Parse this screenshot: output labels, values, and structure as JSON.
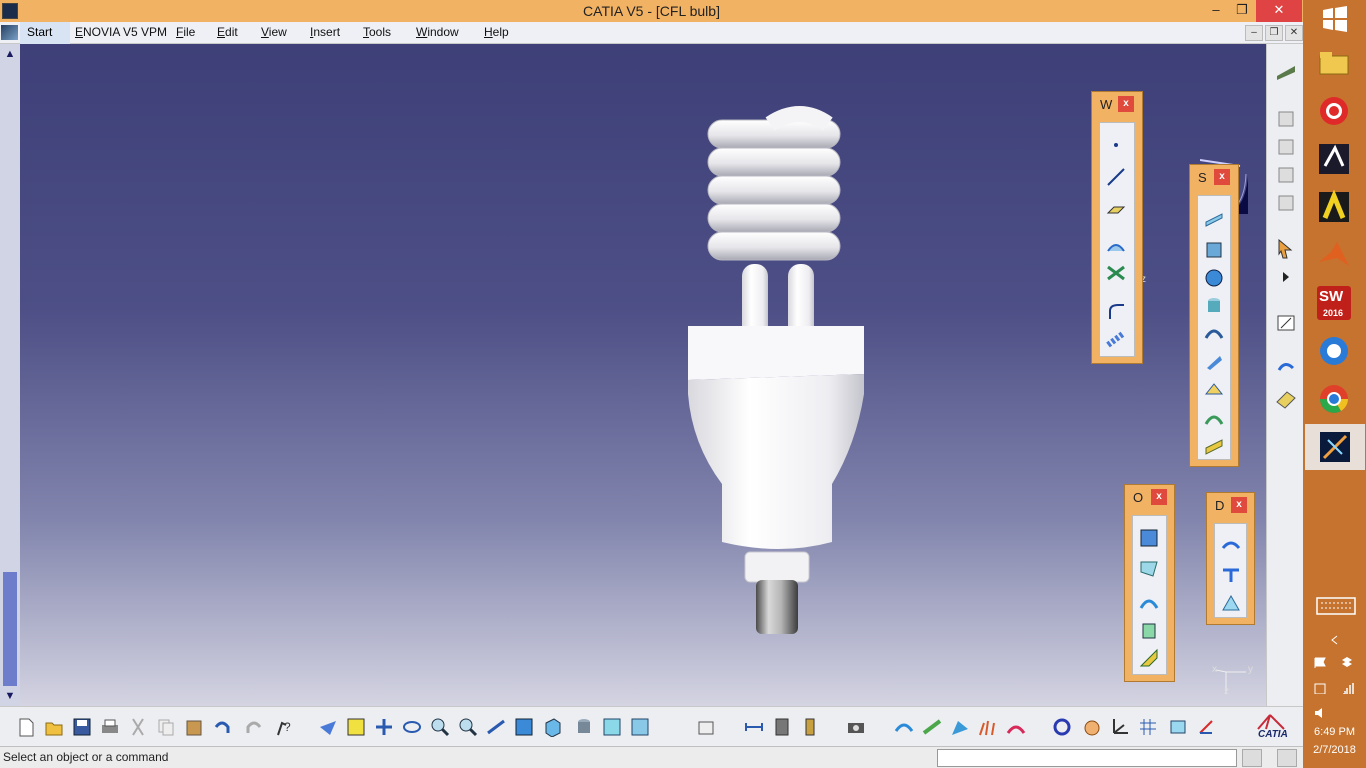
{
  "window": {
    "title": "CATIA V5 - [CFL bulb]",
    "minimize": "–",
    "restore": "❐",
    "close": "✕"
  },
  "menubar": {
    "items": [
      "Start",
      "ENOVIA V5 VPM",
      "File",
      "Edit",
      "View",
      "Insert",
      "Tools",
      "Window",
      "Help"
    ],
    "doc_minimize": "–",
    "doc_restore": "❐",
    "doc_close": "✕"
  },
  "toolbars": {
    "wireframe": {
      "title": "W",
      "close": "x"
    },
    "surfaces": {
      "title": "S",
      "close": "x"
    },
    "operations": {
      "title": "O",
      "close": "x"
    },
    "developed": {
      "title": "D",
      "close": "x"
    }
  },
  "compass": {
    "z_label": "z"
  },
  "axis_triad": {
    "y": "y",
    "z": "z",
    "x": "x"
  },
  "brand": {
    "logo_text": "CATIA"
  },
  "statusbar": {
    "message": "Select an object or a command",
    "command_value": ""
  },
  "taskbar": {
    "time": "6:49 PM",
    "date": "2/7/2018",
    "sw_badge": "2016",
    "sw_label": "SW"
  },
  "colors": {
    "title_bar": "#f2b264",
    "taskbar": "#c5732e",
    "viewport_top": "#3e3f78",
    "viewport_bottom": "#d4d4e2",
    "close_red": "#e04343"
  }
}
